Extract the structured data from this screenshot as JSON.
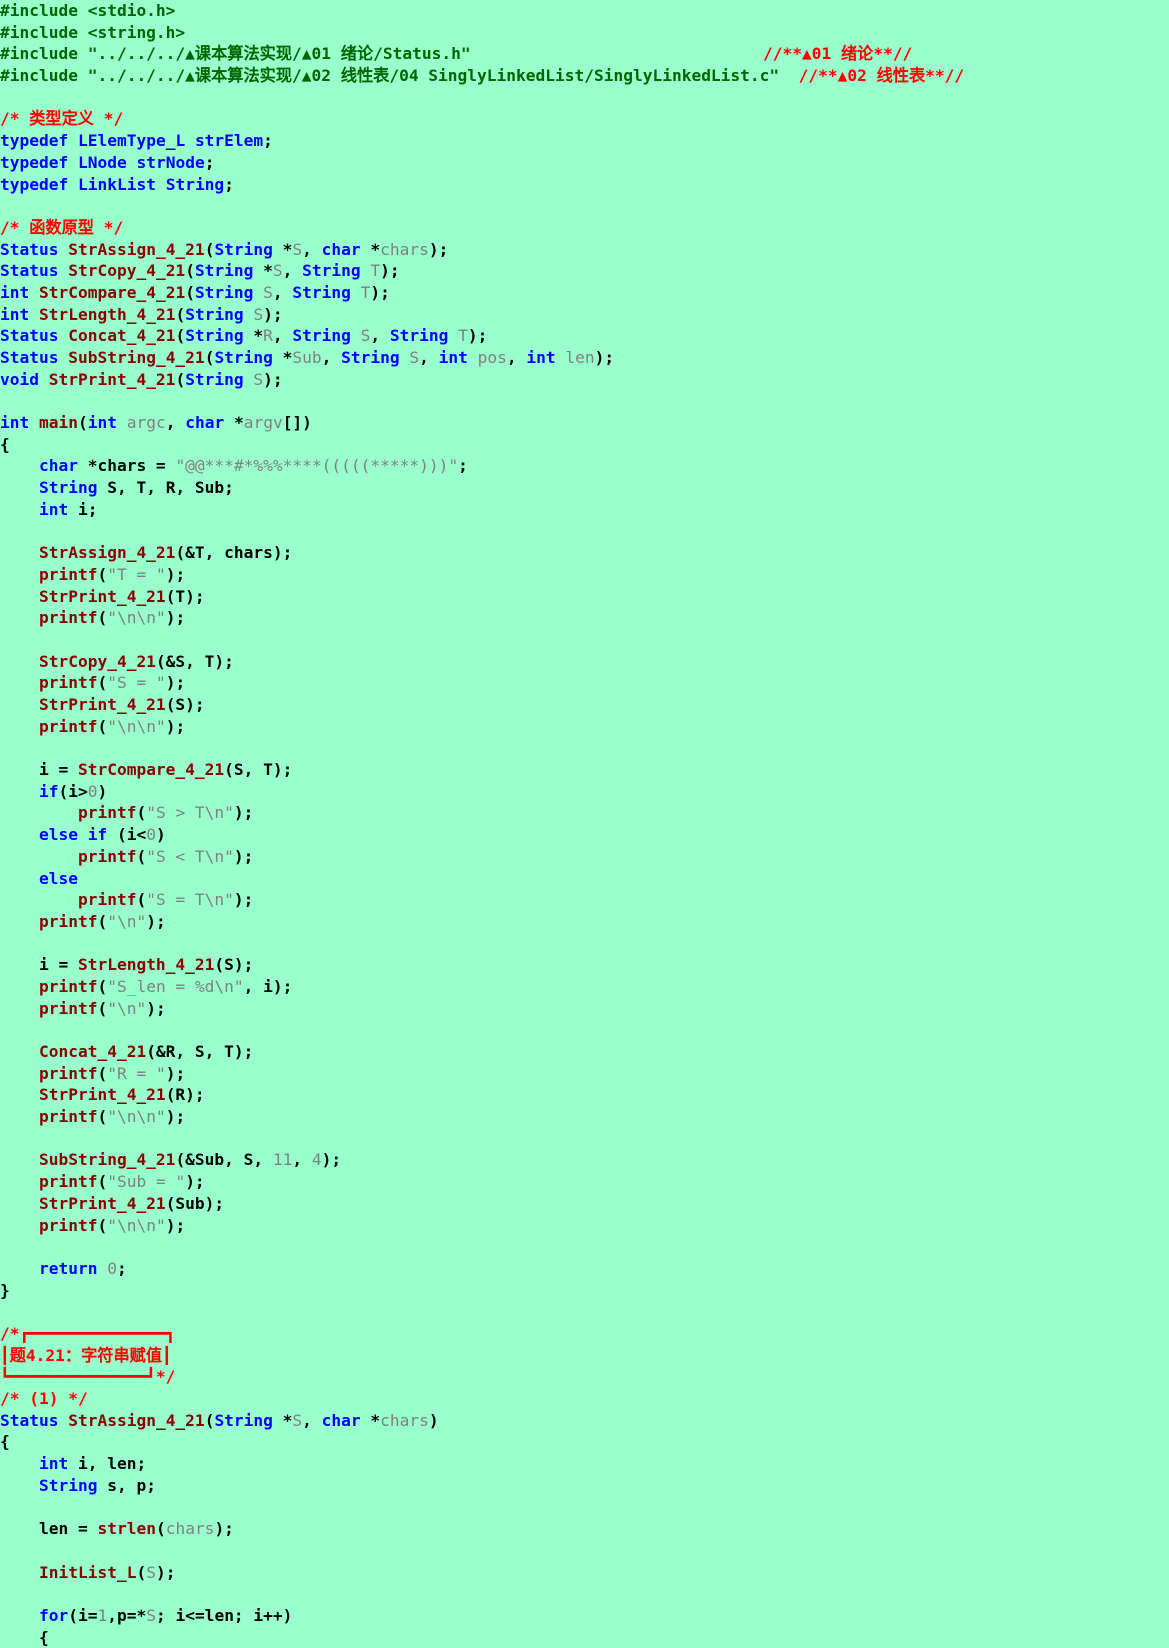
{
  "colors": {
    "background": "#99ffcc",
    "preprocessor": "#006400",
    "comment": "#ff0000",
    "keyword": "#0000ff",
    "type": "#0000ff",
    "function": "#8b0000",
    "string": "#808080",
    "number": "#808080",
    "parameter": "#808080",
    "text": "#000000"
  },
  "lines": [
    [
      [
        "pp",
        "#include <stdio.h>"
      ]
    ],
    [
      [
        "pp",
        "#include <string.h>"
      ]
    ],
    [
      [
        "pp",
        "#include \"../../../▲课本算法实现/▲01 绪论/Status.h\"                              "
      ],
      [
        "cm",
        "//**▲01 绪论**//"
      ]
    ],
    [
      [
        "pp",
        "#include \"../../../▲课本算法实现/▲02 线性表/04 SinglyLinkedList/SinglyLinkedList.c\"  "
      ],
      [
        "cm",
        "//**▲02 线性表**//"
      ]
    ],
    [],
    [
      [
        "cm",
        "/* 类型定义 */"
      ]
    ],
    [
      [
        "kw",
        "typedef"
      ],
      [
        "txt",
        " "
      ],
      [
        "ty",
        "LElemType_L"
      ],
      [
        "txt",
        " "
      ],
      [
        "ty",
        "strElem"
      ],
      [
        "txt",
        ";"
      ]
    ],
    [
      [
        "kw",
        "typedef"
      ],
      [
        "txt",
        " "
      ],
      [
        "ty",
        "LNode"
      ],
      [
        "txt",
        " "
      ],
      [
        "ty",
        "strNode"
      ],
      [
        "txt",
        ";"
      ]
    ],
    [
      [
        "kw",
        "typedef"
      ],
      [
        "txt",
        " "
      ],
      [
        "ty",
        "LinkList"
      ],
      [
        "txt",
        " "
      ],
      [
        "ty",
        "String"
      ],
      [
        "txt",
        ";"
      ]
    ],
    [],
    [
      [
        "cm",
        "/* 函数原型 */"
      ]
    ],
    [
      [
        "ty",
        "Status"
      ],
      [
        "txt",
        " "
      ],
      [
        "fn",
        "StrAssign_4_21"
      ],
      [
        "txt",
        "("
      ],
      [
        "ty",
        "String"
      ],
      [
        "txt",
        " *"
      ],
      [
        "par",
        "S"
      ],
      [
        "txt",
        ", "
      ],
      [
        "kw",
        "char"
      ],
      [
        "txt",
        " *"
      ],
      [
        "par",
        "chars"
      ],
      [
        "txt",
        ");"
      ]
    ],
    [
      [
        "ty",
        "Status"
      ],
      [
        "txt",
        " "
      ],
      [
        "fn",
        "StrCopy_4_21"
      ],
      [
        "txt",
        "("
      ],
      [
        "ty",
        "String"
      ],
      [
        "txt",
        " *"
      ],
      [
        "par",
        "S"
      ],
      [
        "txt",
        ", "
      ],
      [
        "ty",
        "String"
      ],
      [
        "txt",
        " "
      ],
      [
        "par",
        "T"
      ],
      [
        "txt",
        ");"
      ]
    ],
    [
      [
        "kw",
        "int"
      ],
      [
        "txt",
        " "
      ],
      [
        "fn",
        "StrCompare_4_21"
      ],
      [
        "txt",
        "("
      ],
      [
        "ty",
        "String"
      ],
      [
        "txt",
        " "
      ],
      [
        "par",
        "S"
      ],
      [
        "txt",
        ", "
      ],
      [
        "ty",
        "String"
      ],
      [
        "txt",
        " "
      ],
      [
        "par",
        "T"
      ],
      [
        "txt",
        ");"
      ]
    ],
    [
      [
        "kw",
        "int"
      ],
      [
        "txt",
        " "
      ],
      [
        "fn",
        "StrLength_4_21"
      ],
      [
        "txt",
        "("
      ],
      [
        "ty",
        "String"
      ],
      [
        "txt",
        " "
      ],
      [
        "par",
        "S"
      ],
      [
        "txt",
        ");"
      ]
    ],
    [
      [
        "ty",
        "Status"
      ],
      [
        "txt",
        " "
      ],
      [
        "fn",
        "Concat_4_21"
      ],
      [
        "txt",
        "("
      ],
      [
        "ty",
        "String"
      ],
      [
        "txt",
        " *"
      ],
      [
        "par",
        "R"
      ],
      [
        "txt",
        ", "
      ],
      [
        "ty",
        "String"
      ],
      [
        "txt",
        " "
      ],
      [
        "par",
        "S"
      ],
      [
        "txt",
        ", "
      ],
      [
        "ty",
        "String"
      ],
      [
        "txt",
        " "
      ],
      [
        "par",
        "T"
      ],
      [
        "txt",
        ");"
      ]
    ],
    [
      [
        "ty",
        "Status"
      ],
      [
        "txt",
        " "
      ],
      [
        "fn",
        "SubString_4_21"
      ],
      [
        "txt",
        "("
      ],
      [
        "ty",
        "String"
      ],
      [
        "txt",
        " *"
      ],
      [
        "par",
        "Sub"
      ],
      [
        "txt",
        ", "
      ],
      [
        "ty",
        "String"
      ],
      [
        "txt",
        " "
      ],
      [
        "par",
        "S"
      ],
      [
        "txt",
        ", "
      ],
      [
        "kw",
        "int"
      ],
      [
        "txt",
        " "
      ],
      [
        "par",
        "pos"
      ],
      [
        "txt",
        ", "
      ],
      [
        "kw",
        "int"
      ],
      [
        "txt",
        " "
      ],
      [
        "par",
        "len"
      ],
      [
        "txt",
        ");"
      ]
    ],
    [
      [
        "kw",
        "void"
      ],
      [
        "txt",
        " "
      ],
      [
        "fn",
        "StrPrint_4_21"
      ],
      [
        "txt",
        "("
      ],
      [
        "ty",
        "String"
      ],
      [
        "txt",
        " "
      ],
      [
        "par",
        "S"
      ],
      [
        "txt",
        ");"
      ]
    ],
    [],
    [
      [
        "kw",
        "int"
      ],
      [
        "txt",
        " "
      ],
      [
        "fn",
        "main"
      ],
      [
        "txt",
        "("
      ],
      [
        "kw",
        "int"
      ],
      [
        "txt",
        " "
      ],
      [
        "par",
        "argc"
      ],
      [
        "txt",
        ", "
      ],
      [
        "kw",
        "char"
      ],
      [
        "txt",
        " *"
      ],
      [
        "par",
        "argv"
      ],
      [
        "txt",
        "[])"
      ]
    ],
    [
      [
        "txt",
        "{"
      ]
    ],
    [
      [
        "txt",
        "    "
      ],
      [
        "kw",
        "char"
      ],
      [
        "txt",
        " *chars = "
      ],
      [
        "str",
        "\"@@***#*%%%****(((((*****)))\""
      ],
      [
        "txt",
        ";"
      ]
    ],
    [
      [
        "txt",
        "    "
      ],
      [
        "ty",
        "String"
      ],
      [
        "txt",
        " S, T, R, Sub;"
      ]
    ],
    [
      [
        "txt",
        "    "
      ],
      [
        "kw",
        "int"
      ],
      [
        "txt",
        " i;"
      ]
    ],
    [],
    [
      [
        "txt",
        "    "
      ],
      [
        "fn",
        "StrAssign_4_21"
      ],
      [
        "txt",
        "(&T, chars);"
      ]
    ],
    [
      [
        "txt",
        "    "
      ],
      [
        "fn",
        "printf"
      ],
      [
        "txt",
        "("
      ],
      [
        "str",
        "\"T = \""
      ],
      [
        "txt",
        ");"
      ]
    ],
    [
      [
        "txt",
        "    "
      ],
      [
        "fn",
        "StrPrint_4_21"
      ],
      [
        "txt",
        "(T);"
      ]
    ],
    [
      [
        "txt",
        "    "
      ],
      [
        "fn",
        "printf"
      ],
      [
        "txt",
        "("
      ],
      [
        "str",
        "\"\\n\\n\""
      ],
      [
        "txt",
        ");"
      ]
    ],
    [],
    [
      [
        "txt",
        "    "
      ],
      [
        "fn",
        "StrCopy_4_21"
      ],
      [
        "txt",
        "(&S, T);"
      ]
    ],
    [
      [
        "txt",
        "    "
      ],
      [
        "fn",
        "printf"
      ],
      [
        "txt",
        "("
      ],
      [
        "str",
        "\"S = \""
      ],
      [
        "txt",
        ");"
      ]
    ],
    [
      [
        "txt",
        "    "
      ],
      [
        "fn",
        "StrPrint_4_21"
      ],
      [
        "txt",
        "(S);"
      ]
    ],
    [
      [
        "txt",
        "    "
      ],
      [
        "fn",
        "printf"
      ],
      [
        "txt",
        "("
      ],
      [
        "str",
        "\"\\n\\n\""
      ],
      [
        "txt",
        ");"
      ]
    ],
    [],
    [
      [
        "txt",
        "    i = "
      ],
      [
        "fn",
        "StrCompare_4_21"
      ],
      [
        "txt",
        "(S, T);"
      ]
    ],
    [
      [
        "txt",
        "    "
      ],
      [
        "kw",
        "if"
      ],
      [
        "txt",
        "(i>"
      ],
      [
        "num",
        "0"
      ],
      [
        "txt",
        ")"
      ]
    ],
    [
      [
        "txt",
        "        "
      ],
      [
        "fn",
        "printf"
      ],
      [
        "txt",
        "("
      ],
      [
        "str",
        "\"S > T\\n\""
      ],
      [
        "txt",
        ");"
      ]
    ],
    [
      [
        "txt",
        "    "
      ],
      [
        "kw",
        "else if"
      ],
      [
        "txt",
        " (i<"
      ],
      [
        "num",
        "0"
      ],
      [
        "txt",
        ")"
      ]
    ],
    [
      [
        "txt",
        "        "
      ],
      [
        "fn",
        "printf"
      ],
      [
        "txt",
        "("
      ],
      [
        "str",
        "\"S < T\\n\""
      ],
      [
        "txt",
        ");"
      ]
    ],
    [
      [
        "txt",
        "    "
      ],
      [
        "kw",
        "else"
      ]
    ],
    [
      [
        "txt",
        "        "
      ],
      [
        "fn",
        "printf"
      ],
      [
        "txt",
        "("
      ],
      [
        "str",
        "\"S = T\\n\""
      ],
      [
        "txt",
        ");"
      ]
    ],
    [
      [
        "txt",
        "    "
      ],
      [
        "fn",
        "printf"
      ],
      [
        "txt",
        "("
      ],
      [
        "str",
        "\"\\n\""
      ],
      [
        "txt",
        ");"
      ]
    ],
    [],
    [
      [
        "txt",
        "    i = "
      ],
      [
        "fn",
        "StrLength_4_21"
      ],
      [
        "txt",
        "(S);"
      ]
    ],
    [
      [
        "txt",
        "    "
      ],
      [
        "fn",
        "printf"
      ],
      [
        "txt",
        "("
      ],
      [
        "str",
        "\"S_len = %d\\n\""
      ],
      [
        "txt",
        ", i);"
      ]
    ],
    [
      [
        "txt",
        "    "
      ],
      [
        "fn",
        "printf"
      ],
      [
        "txt",
        "("
      ],
      [
        "str",
        "\"\\n\""
      ],
      [
        "txt",
        ");"
      ]
    ],
    [],
    [
      [
        "txt",
        "    "
      ],
      [
        "fn",
        "Concat_4_21"
      ],
      [
        "txt",
        "(&R, S, T);"
      ]
    ],
    [
      [
        "txt",
        "    "
      ],
      [
        "fn",
        "printf"
      ],
      [
        "txt",
        "("
      ],
      [
        "str",
        "\"R = \""
      ],
      [
        "txt",
        ");"
      ]
    ],
    [
      [
        "txt",
        "    "
      ],
      [
        "fn",
        "StrPrint_4_21"
      ],
      [
        "txt",
        "(R);"
      ]
    ],
    [
      [
        "txt",
        "    "
      ],
      [
        "fn",
        "printf"
      ],
      [
        "txt",
        "("
      ],
      [
        "str",
        "\"\\n\\n\""
      ],
      [
        "txt",
        ");"
      ]
    ],
    [],
    [
      [
        "txt",
        "    "
      ],
      [
        "fn",
        "SubString_4_21"
      ],
      [
        "txt",
        "(&Sub, S, "
      ],
      [
        "num",
        "11"
      ],
      [
        "txt",
        ", "
      ],
      [
        "num",
        "4"
      ],
      [
        "txt",
        ");"
      ]
    ],
    [
      [
        "txt",
        "    "
      ],
      [
        "fn",
        "printf"
      ],
      [
        "txt",
        "("
      ],
      [
        "str",
        "\"Sub = \""
      ],
      [
        "txt",
        ");"
      ]
    ],
    [
      [
        "txt",
        "    "
      ],
      [
        "fn",
        "StrPrint_4_21"
      ],
      [
        "txt",
        "(Sub);"
      ]
    ],
    [
      [
        "txt",
        "    "
      ],
      [
        "fn",
        "printf"
      ],
      [
        "txt",
        "("
      ],
      [
        "str",
        "\"\\n\\n\""
      ],
      [
        "txt",
        ");"
      ]
    ],
    [],
    [
      [
        "txt",
        "    "
      ],
      [
        "kw",
        "return"
      ],
      [
        "txt",
        " "
      ],
      [
        "num",
        "0"
      ],
      [
        "txt",
        ";"
      ]
    ],
    [
      [
        "txt",
        "}"
      ]
    ],
    [],
    [
      [
        "cm",
        "/*┏━━━━━━━━━━━━━━┓"
      ]
    ],
    [
      [
        "cm",
        "┃题4.21：字符串赋值┃"
      ]
    ],
    [
      [
        "cm",
        "┗━━━━━━━━━━━━━━┛*/"
      ]
    ],
    [
      [
        "cm",
        "/* (1) */"
      ]
    ],
    [
      [
        "ty",
        "Status"
      ],
      [
        "txt",
        " "
      ],
      [
        "fn",
        "StrAssign_4_21"
      ],
      [
        "txt",
        "("
      ],
      [
        "ty",
        "String"
      ],
      [
        "txt",
        " *"
      ],
      [
        "par",
        "S"
      ],
      [
        "txt",
        ", "
      ],
      [
        "kw",
        "char"
      ],
      [
        "txt",
        " *"
      ],
      [
        "par",
        "chars"
      ],
      [
        "txt",
        ")"
      ]
    ],
    [
      [
        "txt",
        "{"
      ]
    ],
    [
      [
        "txt",
        "    "
      ],
      [
        "kw",
        "int"
      ],
      [
        "txt",
        " i, len;"
      ]
    ],
    [
      [
        "txt",
        "    "
      ],
      [
        "ty",
        "String"
      ],
      [
        "txt",
        " s, p;"
      ]
    ],
    [],
    [
      [
        "txt",
        "    len = "
      ],
      [
        "fn",
        "strlen"
      ],
      [
        "txt",
        "("
      ],
      [
        "par",
        "chars"
      ],
      [
        "txt",
        ");"
      ]
    ],
    [],
    [
      [
        "txt",
        "    "
      ],
      [
        "fn",
        "InitList_L"
      ],
      [
        "txt",
        "("
      ],
      [
        "par",
        "S"
      ],
      [
        "txt",
        ");"
      ]
    ],
    [],
    [
      [
        "txt",
        "    "
      ],
      [
        "kw",
        "for"
      ],
      [
        "txt",
        "(i="
      ],
      [
        "num",
        "1"
      ],
      [
        "txt",
        ",p=*"
      ],
      [
        "par",
        "S"
      ],
      [
        "txt",
        "; i<=len; i++)"
      ]
    ],
    [
      [
        "txt",
        "    {"
      ]
    ]
  ]
}
